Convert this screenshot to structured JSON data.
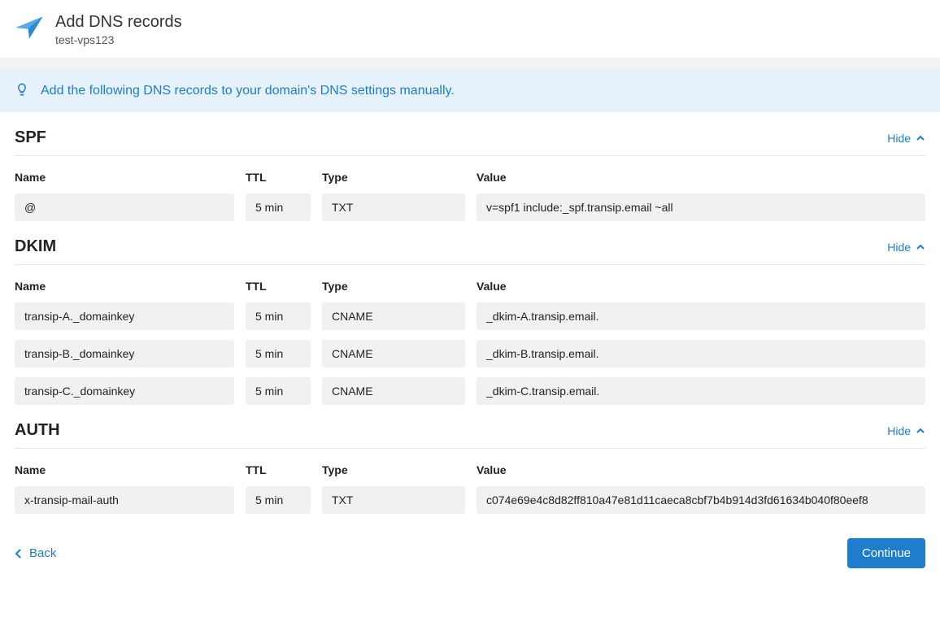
{
  "header": {
    "title": "Add DNS records",
    "subtitle": "test-vps123"
  },
  "info": {
    "text": "Add the following DNS records to your domain's DNS settings manually."
  },
  "columns": {
    "name": "Name",
    "ttl": "TTL",
    "type": "Type",
    "value": "Value"
  },
  "hide_label": "Hide",
  "sections": {
    "spf": {
      "title": "SPF",
      "rows": [
        {
          "name": "@",
          "ttl": "5 min",
          "type": "TXT",
          "value": "v=spf1 include:_spf.transip.email ~all"
        }
      ]
    },
    "dkim": {
      "title": "DKIM",
      "rows": [
        {
          "name": "transip-A._domainkey",
          "ttl": "5 min",
          "type": "CNAME",
          "value": "_dkim-A.transip.email."
        },
        {
          "name": "transip-B._domainkey",
          "ttl": "5 min",
          "type": "CNAME",
          "value": "_dkim-B.transip.email."
        },
        {
          "name": "transip-C._domainkey",
          "ttl": "5 min",
          "type": "CNAME",
          "value": "_dkim-C.transip.email."
        }
      ]
    },
    "auth": {
      "title": "AUTH",
      "rows": [
        {
          "name": "x-transip-mail-auth",
          "ttl": "5 min",
          "type": "TXT",
          "value": "c074e69e4c8d82ff810a47e81d11caeca8cbf7b4b914d3fd61634b040f80eef8"
        }
      ]
    }
  },
  "footer": {
    "back": "Back",
    "continue": "Continue"
  }
}
